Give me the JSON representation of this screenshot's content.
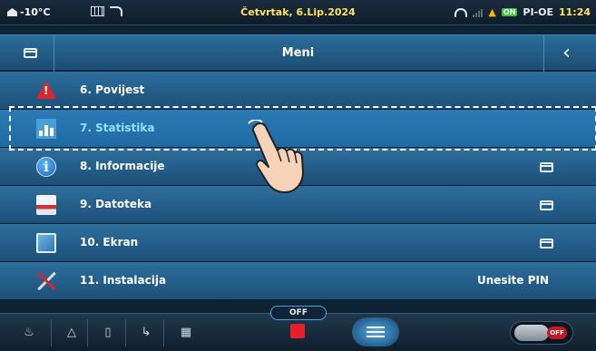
{
  "status_bar": {
    "temperature": "-10°C",
    "date": "Četvrtak, 6.Lip.2024",
    "on_badge": "ON",
    "mode": "PI-OE",
    "time": "11:24"
  },
  "title_bar": {
    "title": "Meni",
    "back_symbol": "‹"
  },
  "menu": {
    "items": [
      {
        "number": "6.",
        "label": "6.  Povijest",
        "icon": "warning-icon",
        "trailing": ""
      },
      {
        "number": "7.",
        "label": "7.  Statistika",
        "icon": "statistics-icon",
        "trailing": "",
        "selected": true
      },
      {
        "number": "8.",
        "label": "8.  Informacije",
        "icon": "info-icon",
        "trailing": "folder-icon"
      },
      {
        "number": "9.",
        "label": "9.  Datoteka",
        "icon": "file-icon",
        "trailing": "folder-icon"
      },
      {
        "number": "10.",
        "label": "10. Ekran",
        "icon": "monitor-icon",
        "trailing": "folder-icon"
      },
      {
        "number": "11.",
        "label": "11. Instalacija",
        "icon": "tools-icon",
        "trailing_text": "Unesite PIN"
      }
    ]
  },
  "bottom_bar": {
    "off_label": "OFF",
    "toggle_label": "OFF"
  },
  "colors": {
    "accent": "#1f6aa3",
    "date_yellow": "#ffe25a",
    "stop_red": "#e81e2a",
    "selected_text": "#8fe3ff"
  }
}
